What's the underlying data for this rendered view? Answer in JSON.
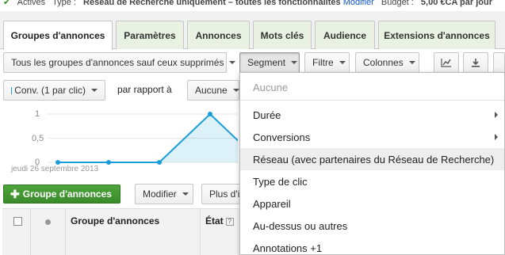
{
  "status_bar": {
    "status": "Actives",
    "type_label": "Type :",
    "type_value": "Réseau de Recherche uniquement – toutes les fonctionnalités",
    "modify_link": "Modifier",
    "budget_label": "Budget :",
    "budget_value": "5,00 €CA par jour"
  },
  "tabs": [
    {
      "label": "Groupes d'annonces",
      "active": true
    },
    {
      "label": "Paramètres"
    },
    {
      "label": "Annonces"
    },
    {
      "label": "Mots clés"
    },
    {
      "label": "Audience"
    },
    {
      "label": "Extensions d'annonces"
    }
  ],
  "toolbar": {
    "filter_select": "Tous les groupes d'annonces sauf ceux supprimés",
    "segment": "Segment",
    "filtre": "Filtre",
    "colonnes": "Colonnes"
  },
  "graph_controls": {
    "metric": "Conv. (1 par clic)",
    "compare_label": "par rapport à",
    "compare_metric": "Aucune",
    "metric_color": "#1a9ed9"
  },
  "chart_data": {
    "type": "area",
    "x": [
      "jeudi 26 septembre 2013",
      "",
      "",
      "",
      ""
    ],
    "values": [
      0,
      0,
      0,
      1,
      0
    ],
    "y_ticks": [
      "1",
      "0,5",
      "0"
    ],
    "ylim": [
      0,
      1
    ],
    "x_start_label": "jeudi 26 septembre 2013",
    "color": "#1a9ed9"
  },
  "actions": {
    "add_group": "Groupe d'annonces",
    "modifier": "Modifier",
    "plus": "Plus d'ir"
  },
  "table": {
    "columns": [
      "Groupe d'annonces",
      "État"
    ],
    "help": "?"
  },
  "segment_menu": [
    {
      "label": "Aucune",
      "dim": true
    },
    {
      "label": "Durée",
      "submenu": true
    },
    {
      "label": "Conversions",
      "submenu": true
    },
    {
      "label": "Réseau (avec partenaires du Réseau de Recherche)",
      "highlighted": true
    },
    {
      "label": "Type de clic"
    },
    {
      "label": "Appareil"
    },
    {
      "label": "Au-dessus ou autres"
    },
    {
      "label": "Annotations +1"
    }
  ]
}
